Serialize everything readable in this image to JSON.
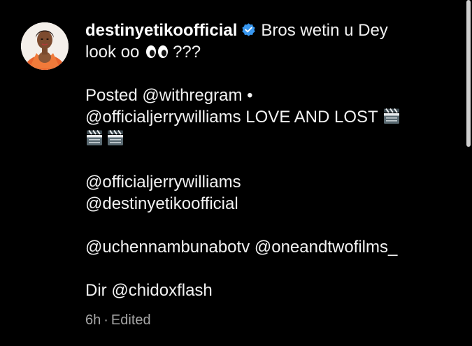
{
  "post": {
    "author": {
      "username": "destinyetikoofficial",
      "verified": true,
      "verified_icon": "verified-badge-icon",
      "avatar_icon": "profile-avatar"
    },
    "caption": {
      "first_text": "Bros wetin u Dey",
      "second_line_start": "look oo",
      "second_line_end": "???",
      "eyes_icon": "eyes-emoji",
      "posted_line": "Posted @withregram •",
      "credit_line": "@officialjerrywilliams LOVE AND LOST",
      "clapper_icon": "clapper-board-emoji",
      "mention_1": "@officialjerrywilliams",
      "mention_2": "@destinyetikoofficial",
      "mention_3": "@uchennambunabotv @oneandtwofilms_",
      "director_line": "Dir @chidoxflash"
    },
    "meta": {
      "time": "6h",
      "separator": "·",
      "edited": "Edited"
    }
  },
  "colors": {
    "background": "#000000",
    "text": "#f2f2f2",
    "meta_text": "#a8a8a8",
    "verified": "#3897f0",
    "scrollbar": "#cfcfcf"
  }
}
